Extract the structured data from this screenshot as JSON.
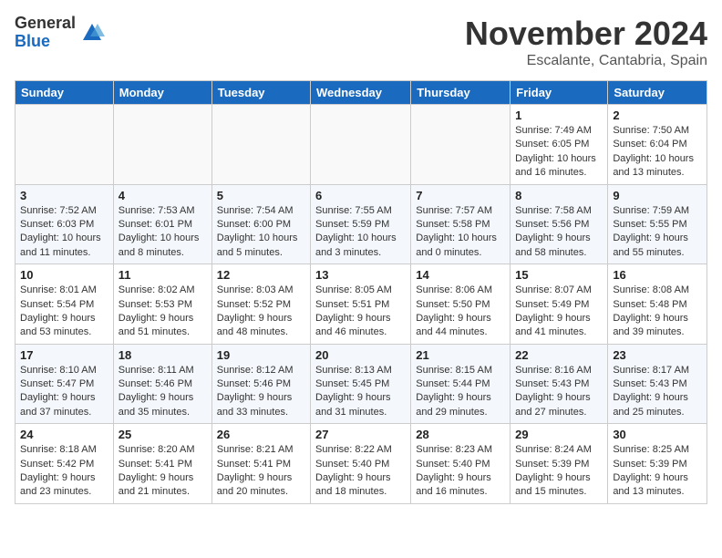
{
  "logo": {
    "general": "General",
    "blue": "Blue"
  },
  "header": {
    "month": "November 2024",
    "location": "Escalante, Cantabria, Spain"
  },
  "weekdays": [
    "Sunday",
    "Monday",
    "Tuesday",
    "Wednesday",
    "Thursday",
    "Friday",
    "Saturday"
  ],
  "weeks": [
    [
      {
        "day": "",
        "info": ""
      },
      {
        "day": "",
        "info": ""
      },
      {
        "day": "",
        "info": ""
      },
      {
        "day": "",
        "info": ""
      },
      {
        "day": "",
        "info": ""
      },
      {
        "day": "1",
        "info": "Sunrise: 7:49 AM\nSunset: 6:05 PM\nDaylight: 10 hours and 16 minutes."
      },
      {
        "day": "2",
        "info": "Sunrise: 7:50 AM\nSunset: 6:04 PM\nDaylight: 10 hours and 13 minutes."
      }
    ],
    [
      {
        "day": "3",
        "info": "Sunrise: 7:52 AM\nSunset: 6:03 PM\nDaylight: 10 hours and 11 minutes."
      },
      {
        "day": "4",
        "info": "Sunrise: 7:53 AM\nSunset: 6:01 PM\nDaylight: 10 hours and 8 minutes."
      },
      {
        "day": "5",
        "info": "Sunrise: 7:54 AM\nSunset: 6:00 PM\nDaylight: 10 hours and 5 minutes."
      },
      {
        "day": "6",
        "info": "Sunrise: 7:55 AM\nSunset: 5:59 PM\nDaylight: 10 hours and 3 minutes."
      },
      {
        "day": "7",
        "info": "Sunrise: 7:57 AM\nSunset: 5:58 PM\nDaylight: 10 hours and 0 minutes."
      },
      {
        "day": "8",
        "info": "Sunrise: 7:58 AM\nSunset: 5:56 PM\nDaylight: 9 hours and 58 minutes."
      },
      {
        "day": "9",
        "info": "Sunrise: 7:59 AM\nSunset: 5:55 PM\nDaylight: 9 hours and 55 minutes."
      }
    ],
    [
      {
        "day": "10",
        "info": "Sunrise: 8:01 AM\nSunset: 5:54 PM\nDaylight: 9 hours and 53 minutes."
      },
      {
        "day": "11",
        "info": "Sunrise: 8:02 AM\nSunset: 5:53 PM\nDaylight: 9 hours and 51 minutes."
      },
      {
        "day": "12",
        "info": "Sunrise: 8:03 AM\nSunset: 5:52 PM\nDaylight: 9 hours and 48 minutes."
      },
      {
        "day": "13",
        "info": "Sunrise: 8:05 AM\nSunset: 5:51 PM\nDaylight: 9 hours and 46 minutes."
      },
      {
        "day": "14",
        "info": "Sunrise: 8:06 AM\nSunset: 5:50 PM\nDaylight: 9 hours and 44 minutes."
      },
      {
        "day": "15",
        "info": "Sunrise: 8:07 AM\nSunset: 5:49 PM\nDaylight: 9 hours and 41 minutes."
      },
      {
        "day": "16",
        "info": "Sunrise: 8:08 AM\nSunset: 5:48 PM\nDaylight: 9 hours and 39 minutes."
      }
    ],
    [
      {
        "day": "17",
        "info": "Sunrise: 8:10 AM\nSunset: 5:47 PM\nDaylight: 9 hours and 37 minutes."
      },
      {
        "day": "18",
        "info": "Sunrise: 8:11 AM\nSunset: 5:46 PM\nDaylight: 9 hours and 35 minutes."
      },
      {
        "day": "19",
        "info": "Sunrise: 8:12 AM\nSunset: 5:46 PM\nDaylight: 9 hours and 33 minutes."
      },
      {
        "day": "20",
        "info": "Sunrise: 8:13 AM\nSunset: 5:45 PM\nDaylight: 9 hours and 31 minutes."
      },
      {
        "day": "21",
        "info": "Sunrise: 8:15 AM\nSunset: 5:44 PM\nDaylight: 9 hours and 29 minutes."
      },
      {
        "day": "22",
        "info": "Sunrise: 8:16 AM\nSunset: 5:43 PM\nDaylight: 9 hours and 27 minutes."
      },
      {
        "day": "23",
        "info": "Sunrise: 8:17 AM\nSunset: 5:43 PM\nDaylight: 9 hours and 25 minutes."
      }
    ],
    [
      {
        "day": "24",
        "info": "Sunrise: 8:18 AM\nSunset: 5:42 PM\nDaylight: 9 hours and 23 minutes."
      },
      {
        "day": "25",
        "info": "Sunrise: 8:20 AM\nSunset: 5:41 PM\nDaylight: 9 hours and 21 minutes."
      },
      {
        "day": "26",
        "info": "Sunrise: 8:21 AM\nSunset: 5:41 PM\nDaylight: 9 hours and 20 minutes."
      },
      {
        "day": "27",
        "info": "Sunrise: 8:22 AM\nSunset: 5:40 PM\nDaylight: 9 hours and 18 minutes."
      },
      {
        "day": "28",
        "info": "Sunrise: 8:23 AM\nSunset: 5:40 PM\nDaylight: 9 hours and 16 minutes."
      },
      {
        "day": "29",
        "info": "Sunrise: 8:24 AM\nSunset: 5:39 PM\nDaylight: 9 hours and 15 minutes."
      },
      {
        "day": "30",
        "info": "Sunrise: 8:25 AM\nSunset: 5:39 PM\nDaylight: 9 hours and 13 minutes."
      }
    ]
  ]
}
